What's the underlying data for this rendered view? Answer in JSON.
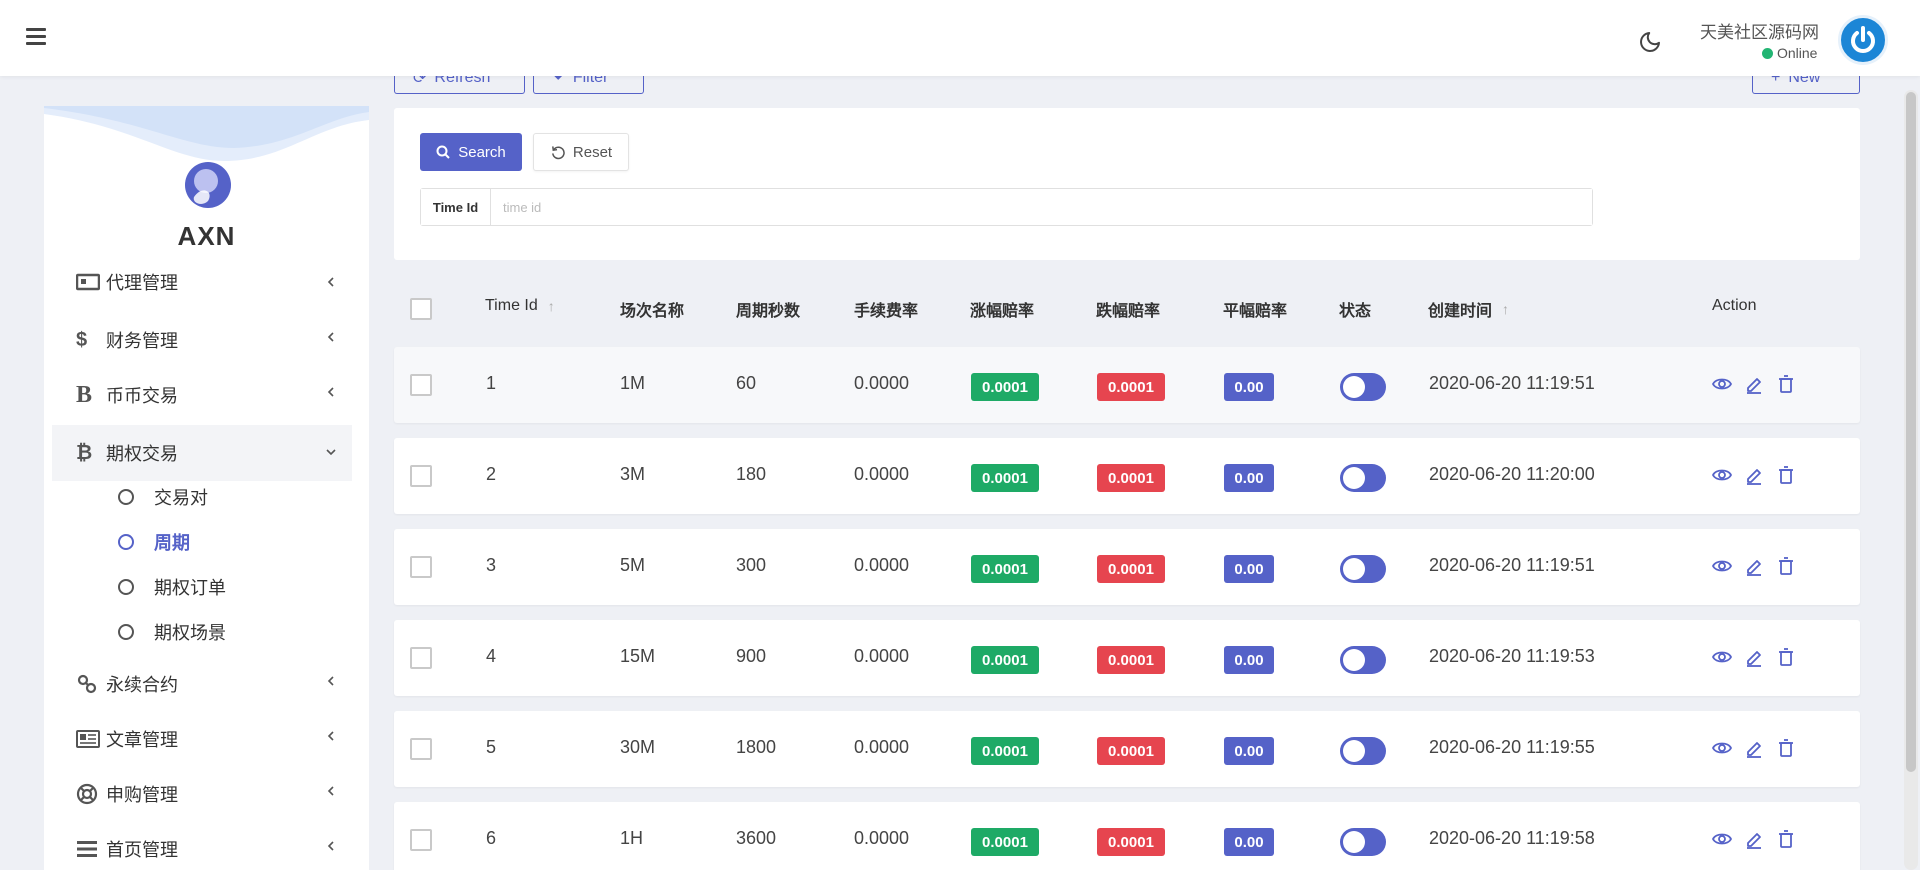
{
  "header": {
    "user_name": "天美社区源码网",
    "status": "Online"
  },
  "toolbar": {
    "refresh_label": "Refresh",
    "filter_label": "Filter",
    "new_label": "New"
  },
  "sidebar": {
    "brand": "AXN",
    "items": [
      {
        "label": "代理管理",
        "icon": "agent-icon"
      },
      {
        "label": "财务管理",
        "icon": "dollar-icon"
      },
      {
        "label": "币币交易",
        "icon": "b-icon"
      },
      {
        "label": "期权交易",
        "icon": "bitcoin-icon",
        "expanded": true
      },
      {
        "label": "永续合约",
        "icon": "link-icon"
      },
      {
        "label": "文章管理",
        "icon": "newspaper-icon"
      },
      {
        "label": "申购管理",
        "icon": "lifebuoy-icon"
      },
      {
        "label": "首页管理",
        "icon": "list-icon"
      }
    ],
    "sub_items": [
      {
        "label": "交易对"
      },
      {
        "label": "周期",
        "current": true
      },
      {
        "label": "期权订单"
      },
      {
        "label": "期权场景"
      }
    ]
  },
  "filter": {
    "search_label": "Search",
    "reset_label": "Reset",
    "field_label": "Time Id",
    "field_placeholder": "time id",
    "field_value": ""
  },
  "table": {
    "headers": {
      "time_id": "Time Id",
      "name": "场次名称",
      "seconds": "周期秒数",
      "fee": "手续费率",
      "rise": "涨幅赔率",
      "fall": "跌幅赔率",
      "flat": "平幅赔率",
      "status": "状态",
      "created": "创建时间",
      "action": "Action"
    },
    "rows": [
      {
        "id": "1",
        "name": "1M",
        "seconds": "60",
        "fee": "0.0000",
        "rise": "0.0001",
        "fall": "0.0001",
        "flat": "0.00",
        "status_on": false,
        "created": "2020-06-20 11:19:51"
      },
      {
        "id": "2",
        "name": "3M",
        "seconds": "180",
        "fee": "0.0000",
        "rise": "0.0001",
        "fall": "0.0001",
        "flat": "0.00",
        "status_on": false,
        "created": "2020-06-20 11:20:00"
      },
      {
        "id": "3",
        "name": "5M",
        "seconds": "300",
        "fee": "0.0000",
        "rise": "0.0001",
        "fall": "0.0001",
        "flat": "0.00",
        "status_on": false,
        "created": "2020-06-20 11:19:51"
      },
      {
        "id": "4",
        "name": "15M",
        "seconds": "900",
        "fee": "0.0000",
        "rise": "0.0001",
        "fall": "0.0001",
        "flat": "0.00",
        "status_on": false,
        "created": "2020-06-20 11:19:53"
      },
      {
        "id": "5",
        "name": "30M",
        "seconds": "1800",
        "fee": "0.0000",
        "rise": "0.0001",
        "fall": "0.0001",
        "flat": "0.00",
        "status_on": false,
        "created": "2020-06-20 11:19:55"
      },
      {
        "id": "6",
        "name": "1H",
        "seconds": "3600",
        "fee": "0.0000",
        "rise": "0.0001",
        "fall": "0.0001",
        "flat": "0.00",
        "status_on": false,
        "created": "2020-06-20 11:19:58"
      }
    ]
  },
  "colors": {
    "primary": "#5562c8",
    "rise": "#1eaa66",
    "fall": "#e6454f",
    "online": "#22b573"
  }
}
